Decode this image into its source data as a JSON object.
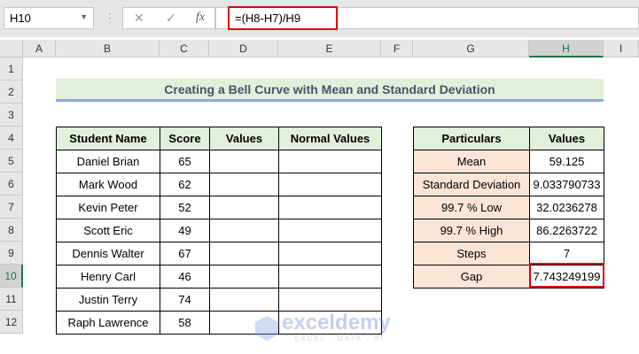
{
  "formula_bar": {
    "name_box": "H10",
    "cancel_icon": "✕",
    "enter_icon": "✓",
    "fx_label": "fx",
    "formula": "=(H8-H7)/H9"
  },
  "columns": [
    "A",
    "B",
    "C",
    "D",
    "E",
    "F",
    "G",
    "H",
    "I"
  ],
  "rows": [
    "1",
    "2",
    "3",
    "4",
    "5",
    "6",
    "7",
    "8",
    "9",
    "10",
    "11",
    "12"
  ],
  "title": "Creating a Bell Curve with Mean and Standard Deviation",
  "left_table": {
    "headers": [
      "Student Name",
      "Score",
      "Values",
      "Normal Values"
    ],
    "rows": [
      [
        "Daniel Brian",
        "65",
        "",
        ""
      ],
      [
        "Mark Wood",
        "62",
        "",
        ""
      ],
      [
        "Kevin Peter",
        "52",
        "",
        ""
      ],
      [
        "Scott Eric",
        "49",
        "",
        ""
      ],
      [
        "Dennis Walter",
        "67",
        "",
        ""
      ],
      [
        "Henry Carl",
        "46",
        "",
        ""
      ],
      [
        "Justin Terry",
        "74",
        "",
        ""
      ],
      [
        "Raph Lawrence",
        "58",
        "",
        ""
      ]
    ]
  },
  "right_table": {
    "headers": [
      "Particulars",
      "Values"
    ],
    "rows": [
      [
        "Mean",
        "59.125"
      ],
      [
        "Standard Deviation",
        "9.033790733"
      ],
      [
        "99.7 % Low",
        "32.0236278"
      ],
      [
        "99.7 % High",
        "86.2263722"
      ],
      [
        "Steps",
        "7"
      ],
      [
        "Gap",
        "7.743249199"
      ]
    ]
  },
  "watermark": {
    "name": "exceldemy",
    "tagline": "EXCEL · DATA · BI"
  }
}
